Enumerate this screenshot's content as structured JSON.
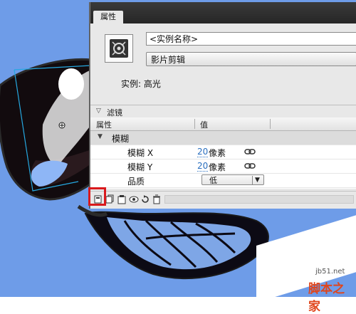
{
  "panel": {
    "tab_label": "属性",
    "instance_name_placeholder": "<实例名称>",
    "symbol_type": "影片剪辑",
    "instance_label": "实例:",
    "instance_value": "高光"
  },
  "filters": {
    "section_title": "滤镜",
    "col_property": "属性",
    "col_value": "值",
    "group": "模糊",
    "rows": [
      {
        "label": "模糊 X",
        "value": "20",
        "unit": "像素"
      },
      {
        "label": "模糊 Y",
        "value": "20",
        "unit": "像素"
      },
      {
        "label": "品质",
        "value": "低"
      }
    ]
  },
  "toolbar": {
    "icons": [
      "add-filter-icon",
      "presets-icon",
      "clipboard-icon",
      "enable-disable-icon",
      "reset-icon",
      "delete-filter-icon"
    ]
  },
  "watermark": {
    "site": "jb51.net",
    "brand": "脚本之家"
  },
  "colors": {
    "stage_bg": "#6e9ce8",
    "highlight": "#d9191c",
    "value_blue": "#2a6fbf"
  }
}
